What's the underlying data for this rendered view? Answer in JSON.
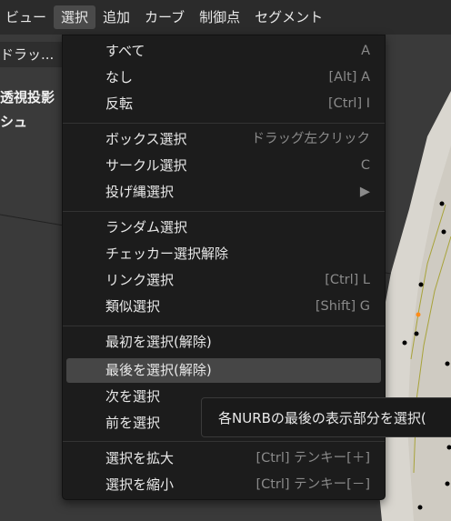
{
  "menubar": {
    "items": [
      "ビュー",
      "選択",
      "追加",
      "カーブ",
      "制御点",
      "セグメント"
    ],
    "active_index": 1
  },
  "header": {
    "mode_label": "ドラッ..."
  },
  "viewport": {
    "overlay_text_1": "透視投影",
    "overlay_text_2": "シュ"
  },
  "select_menu": {
    "items": [
      {
        "label": "すべて",
        "shortcut": "A"
      },
      {
        "label": "なし",
        "shortcut": "[Alt] A"
      },
      {
        "label": "反転",
        "shortcut": "[Ctrl] I"
      },
      {
        "label": "ボックス選択",
        "shortcut": "ドラッグ左クリック"
      },
      {
        "label": "サークル選択",
        "shortcut": "C"
      },
      {
        "label": "投げ縄選択",
        "shortcut": ""
      },
      {
        "label": "ランダム選択",
        "shortcut": ""
      },
      {
        "label": "チェッカー選択解除",
        "shortcut": ""
      },
      {
        "label": "リンク選択",
        "shortcut": "[Ctrl] L"
      },
      {
        "label": "類似選択",
        "shortcut": "[Shift] G"
      },
      {
        "label": "最初を選択(解除)",
        "shortcut": ""
      },
      {
        "label": "最後を選択(解除)",
        "shortcut": ""
      },
      {
        "label": "次を選択",
        "shortcut": ""
      },
      {
        "label": "前を選択",
        "shortcut": ""
      },
      {
        "label": "選択を拡大",
        "shortcut": "[Ctrl] テンキー[＋]"
      },
      {
        "label": "選択を縮小",
        "shortcut": "[Ctrl] テンキー[－]"
      }
    ],
    "submenu_arrow": "▶",
    "hovered_index": 11
  },
  "tooltip": {
    "text": "各NURBの最後の表示部分を選択("
  },
  "colors": {
    "menu_bg": "#1c1c1c",
    "highlight": "#464646",
    "selected_point": "#ff8c1a"
  }
}
